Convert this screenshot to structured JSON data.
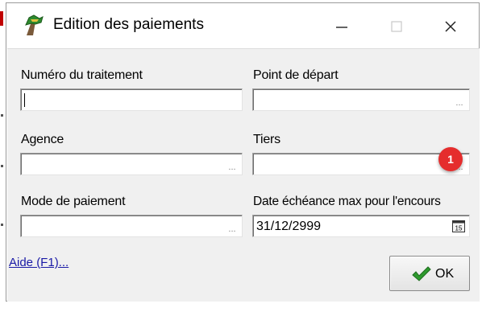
{
  "window": {
    "title": "Edition des paiements",
    "icon": "green-cross-stone-icon"
  },
  "controls": {
    "minimize": "minimize-icon",
    "maximize": "maximize-icon",
    "close": "close-icon"
  },
  "form": {
    "numero_traitement": {
      "label": "Numéro du traitement",
      "value": ""
    },
    "point_depart": {
      "label": "Point de départ",
      "value": "",
      "browse": "..."
    },
    "agence": {
      "label": "Agence",
      "value": "",
      "browse": "..."
    },
    "tiers": {
      "label": "Tiers",
      "value": "",
      "browse": "..."
    },
    "mode_paiement": {
      "label": "Mode de paiement",
      "value": "",
      "browse": "..."
    },
    "date_echeance": {
      "label": "Date échéance max pour l'encours",
      "value": "31/12/2999"
    }
  },
  "annotation": {
    "badge": "1",
    "color": "#e52d2d"
  },
  "footer": {
    "help_link": "Aide (F1)...",
    "ok_label": "OK",
    "ok_icon": "green-checkmark-icon"
  }
}
